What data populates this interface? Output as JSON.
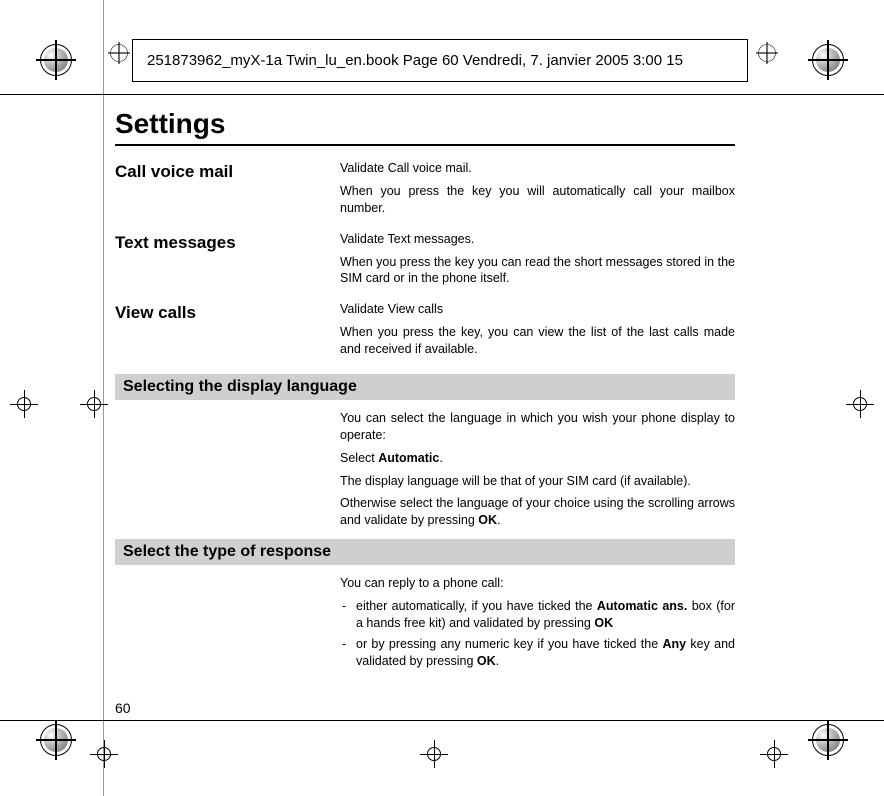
{
  "header": {
    "meta_line": "251873962_myX-1a Twin_lu_en.book  Page 60  Vendredi, 7. janvier 2005  3:00 15"
  },
  "page": {
    "title": "Settings",
    "page_number": "60"
  },
  "items": {
    "call_voice_mail": {
      "label": "Call voice mail",
      "line1": "Validate Call voice mail.",
      "line2": "When you press the key you will automatically call your mailbox number."
    },
    "text_messages": {
      "label": "Text  messages",
      "line1": "Validate Text messages.",
      "line2": "When you press the key you can read the short messages stored in the SIM card or in the phone itself."
    },
    "view_calls": {
      "label": "View calls",
      "line1": "Validate View calls",
      "line2": "When you press the key, you can view the list of the last calls made and received if available."
    }
  },
  "sections": {
    "display_language": {
      "heading": "Selecting the display language",
      "p1": "You can select the language in which you wish your phone display to operate:",
      "p2_pre": "Select ",
      "p2_bold": "Automatic",
      "p2_post": ".",
      "p3": "The display language will be that of your SIM card (if available).",
      "p4_pre": "Otherwise select the language of your choice using the scrolling arrows and validate by pressing ",
      "p4_bold": "OK",
      "p4_post": "."
    },
    "response_type": {
      "heading": "Select the type of response",
      "intro": "You can reply to a phone call:",
      "bullet1_pre": "either automatically, if you have ticked the ",
      "bullet1_bold1": "Automatic ans.",
      "bullet1_mid": " box (for a hands free kit) and validated by pressing ",
      "bullet1_bold2": "OK",
      "bullet2_pre": "or by pressing any numeric key if you have ticked the ",
      "bullet2_bold1": "Any",
      "bullet2_mid": " key and validated by pressing ",
      "bullet2_bold2": "OK",
      "bullet2_post": "."
    }
  }
}
